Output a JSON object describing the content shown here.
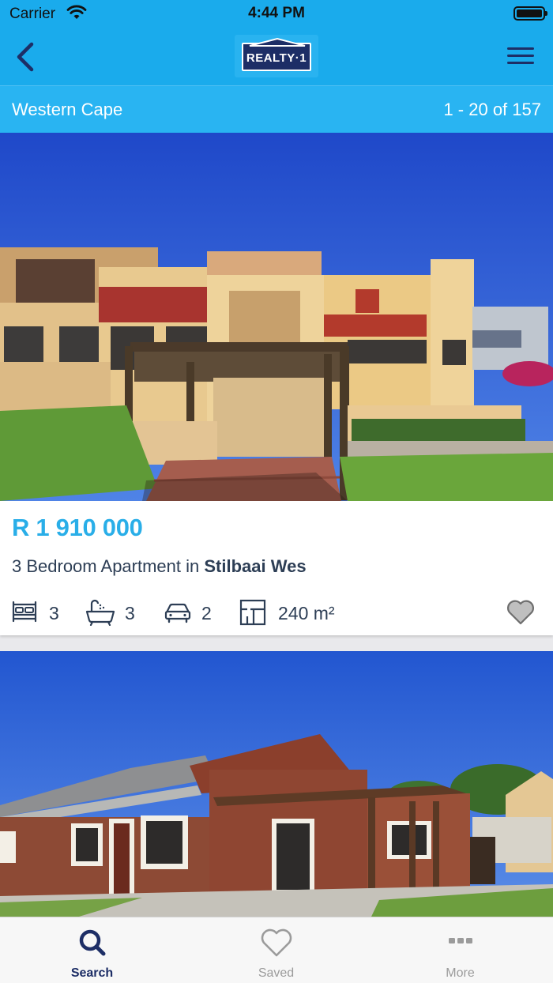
{
  "status_bar": {
    "carrier": "Carrier",
    "time": "4:44 PM"
  },
  "nav": {
    "logo_text": "REALTY·1"
  },
  "region": {
    "name": "Western Cape",
    "count": "1 - 20 of 157"
  },
  "listings": [
    {
      "price": "R 1 910 000",
      "title_prefix": "3 Bedroom Apartment in ",
      "title_location": "Stilbaai Wes",
      "bedrooms": "3",
      "bathrooms": "3",
      "garages": "2",
      "floor_size": "240 m²",
      "favorite": false
    },
    {
      "price": "",
      "title_prefix": "",
      "title_location": ""
    }
  ],
  "tabs": [
    {
      "label": "Search",
      "icon": "search-icon",
      "active": true
    },
    {
      "label": "Saved",
      "icon": "heart-icon",
      "active": false
    },
    {
      "label": "More",
      "icon": "more-dots-icon",
      "active": false
    }
  ],
  "colors": {
    "brand_blue": "#1aabec",
    "navy": "#1d2e66",
    "price_blue": "#29aee8",
    "text_dark": "#2d3e55"
  }
}
